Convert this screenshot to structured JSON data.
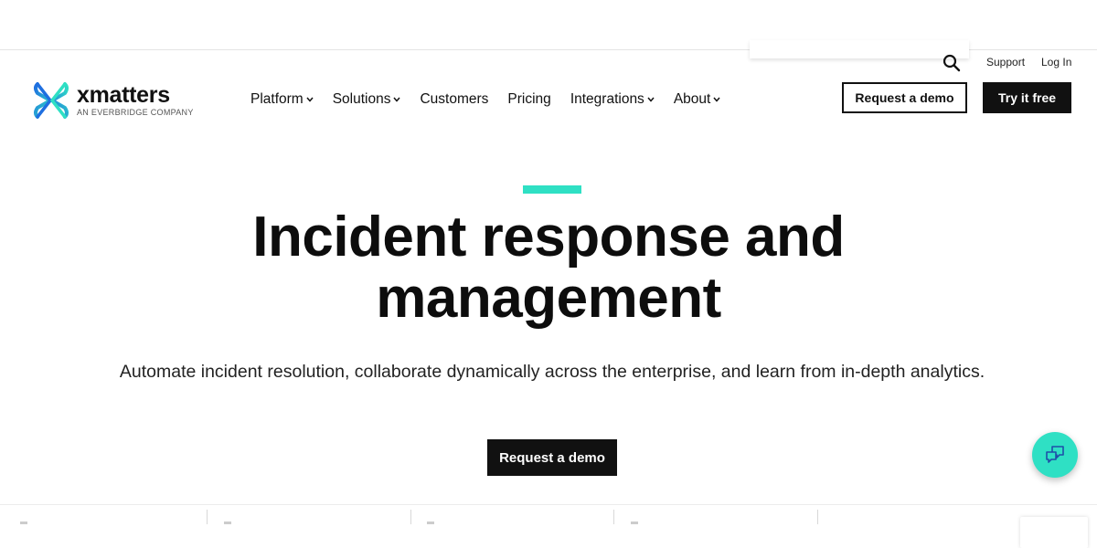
{
  "utility": {
    "support": "Support",
    "login": "Log In"
  },
  "logo": {
    "name": "xmatters",
    "tagline": "AN EVERBRIDGE COMPANY"
  },
  "nav": {
    "items": [
      {
        "label": "Platform",
        "has_dropdown": true
      },
      {
        "label": "Solutions",
        "has_dropdown": true
      },
      {
        "label": "Customers",
        "has_dropdown": false
      },
      {
        "label": "Pricing",
        "has_dropdown": false
      },
      {
        "label": "Integrations",
        "has_dropdown": true
      },
      {
        "label": "About",
        "has_dropdown": true
      }
    ]
  },
  "header_buttons": {
    "request_demo": "Request a demo",
    "try_free": "Try it free"
  },
  "hero": {
    "title": "Incident response and management",
    "subtitle": "Automate incident resolution, collaborate dynamically across the enterprise, and learn from in-depth analytics.",
    "cta": "Request a demo"
  },
  "colors": {
    "accent": "#2fe0c4",
    "dark": "#111111",
    "logo_blue": "#1f6fe0"
  },
  "icons": {
    "search": "search-icon",
    "chat": "chat-icon",
    "chevron": "chevron-down-icon"
  }
}
